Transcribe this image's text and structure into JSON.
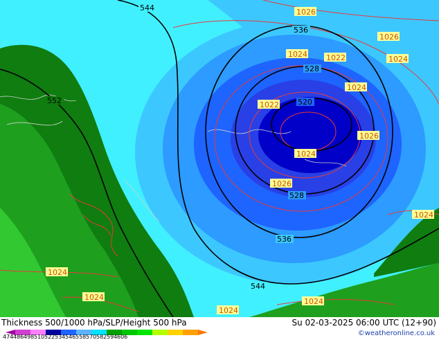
{
  "title": "Thickness 500/1000 hPa/SLP/Height 500 hPa",
  "valid_time": "Su 02-03-2025 06:00 UTC (12+90)",
  "credit": "©weatheronline.co.uk",
  "scale": {
    "ticks": [
      "474",
      "486",
      "498",
      "510",
      "522",
      "534",
      "546",
      "558",
      "570",
      "582",
      "594",
      "606"
    ],
    "colors": [
      "#a000a0",
      "#d040d0",
      "#ff80ff",
      "#0000a0",
      "#1e64ff",
      "#5ab4ff",
      "#00e1ff",
      "#00a000",
      "#00c800",
      "#00e600",
      "#b4ff00",
      "#ffd200",
      "#ffa000"
    ]
  },
  "colors": {
    "ocean": "#41f0ff",
    "low_core": "#0000c8",
    "green_dark": "#0f7d0f",
    "green_mid": "#1ea01e",
    "green_light": "#32c832",
    "slp_isobar": "#e83a3a",
    "height_contour": "#000000",
    "label_bg": "#ffff96"
  },
  "height_labels": [
    "544",
    "536",
    "528",
    "520",
    "552",
    "528",
    "536",
    "544"
  ],
  "slp_labels": [
    "1026",
    "1026",
    "1024",
    "1022",
    "1024",
    "1024",
    "1026",
    "1022",
    "1024",
    "1026",
    "1024",
    "1024",
    "1024",
    "1024",
    "1024",
    "1024",
    "1026",
    "1026"
  ]
}
